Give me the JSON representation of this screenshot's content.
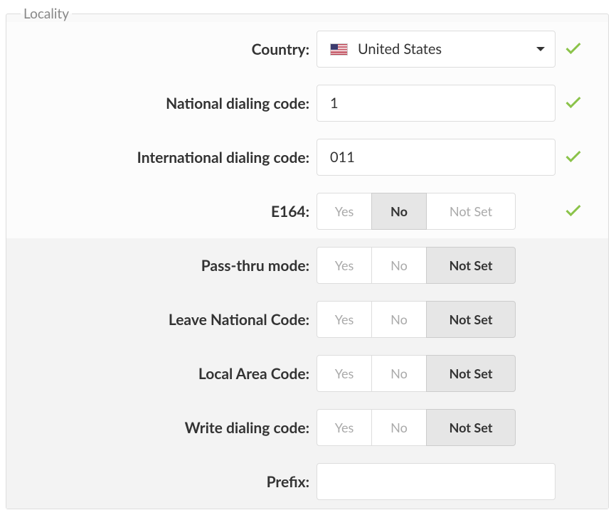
{
  "legend": "Locality",
  "rows": {
    "country": {
      "label": "Country:",
      "value": "United States",
      "icon": "us-flag",
      "validated": true
    },
    "national_dialing": {
      "label": "National dialing code:",
      "value": "1",
      "validated": true
    },
    "international_dialing": {
      "label": "International dialing code:",
      "value": "011",
      "validated": true
    },
    "e164": {
      "label": "E164:",
      "options": {
        "yes": "Yes",
        "no": "No",
        "notset": "Not Set"
      },
      "selected": "no",
      "validated": true
    },
    "pass_thru": {
      "label": "Pass-thru mode:",
      "options": {
        "yes": "Yes",
        "no": "No",
        "notset": "Not Set"
      },
      "selected": "notset"
    },
    "leave_national": {
      "label": "Leave National Code:",
      "options": {
        "yes": "Yes",
        "no": "No",
        "notset": "Not Set"
      },
      "selected": "notset"
    },
    "local_area": {
      "label": "Local Area Code:",
      "options": {
        "yes": "Yes",
        "no": "No",
        "notset": "Not Set"
      },
      "selected": "notset"
    },
    "write_dialing": {
      "label": "Write dialing code:",
      "options": {
        "yes": "Yes",
        "no": "No",
        "notset": "Not Set"
      },
      "selected": "notset"
    },
    "prefix": {
      "label": "Prefix:",
      "value": ""
    }
  },
  "colors": {
    "check": "#8bc34a"
  }
}
